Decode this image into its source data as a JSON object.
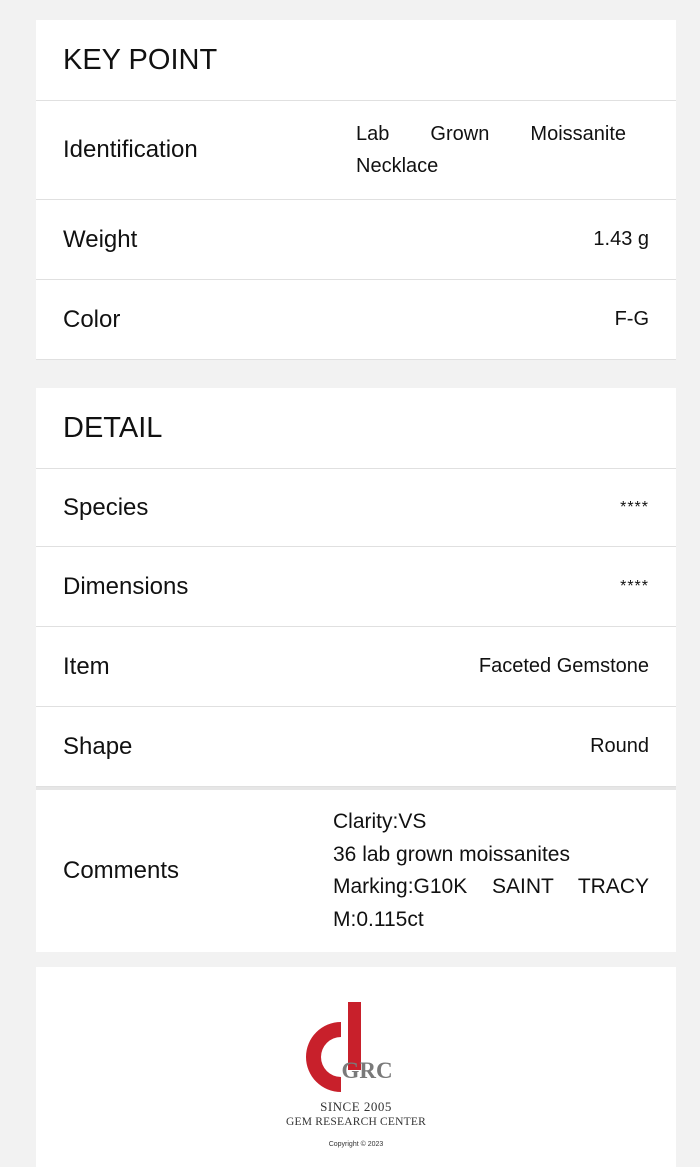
{
  "key_point": {
    "title": "KEY POINT",
    "rows": [
      {
        "label": "Identification",
        "value": "Lab Grown Moissanite Necklace"
      },
      {
        "label": "Weight",
        "value": "1.43 g"
      },
      {
        "label": "Color",
        "value": "F-G"
      }
    ]
  },
  "detail": {
    "title": "DETAIL",
    "rows": [
      {
        "label": "Species",
        "value": "****"
      },
      {
        "label": "Dimensions",
        "value": "****"
      },
      {
        "label": "Item",
        "value": "Faceted Gemstone"
      },
      {
        "label": "Shape",
        "value": "Round"
      }
    ],
    "comments": {
      "label": "Comments",
      "lines": [
        "Clarity:VS",
        "36 lab grown moissanites",
        "Marking:G10K SAINT TRACY",
        "M:0.115ct"
      ]
    }
  },
  "footer": {
    "logo_text": "GRC",
    "since": "SINCE 2005",
    "org_name": "GEM RESEARCH CENTER",
    "copyright": "Copyright © 2023"
  },
  "colors": {
    "logo_red": "#c8202b",
    "logo_gray": "#7a7a7a"
  }
}
